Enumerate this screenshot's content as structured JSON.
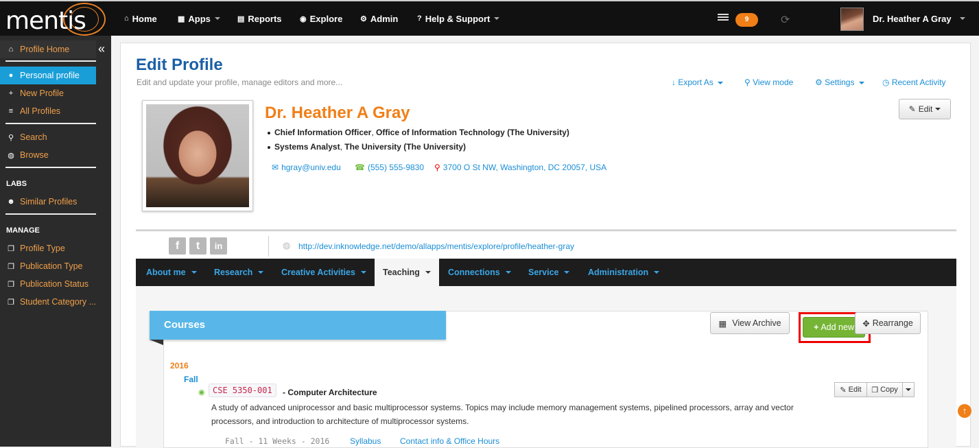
{
  "app": {
    "logo": "mentis"
  },
  "topnav": [
    {
      "icon": "home-icon",
      "glyph": "⌂",
      "label": "Home"
    },
    {
      "icon": "apps-icon",
      "glyph": "▦",
      "label": "Apps"
    },
    {
      "icon": "reports-icon",
      "glyph": "▤",
      "label": "Reports"
    },
    {
      "icon": "explore-icon",
      "glyph": "◉",
      "label": "Explore"
    },
    {
      "icon": "admin-icon",
      "glyph": "⚙",
      "label": "Admin"
    },
    {
      "icon": "help-icon",
      "glyph": "?",
      "label": "Help & Support"
    }
  ],
  "notifications": {
    "count": "9"
  },
  "user": {
    "name": "Dr. Heather A Gray"
  },
  "sidebar": {
    "collapse_glyph": "«",
    "items": [
      {
        "label": "Profile Home",
        "icon": "home-icon",
        "glyph": "⌂"
      },
      {
        "label": "Personal profile",
        "icon": "user-icon",
        "glyph": "●"
      },
      {
        "label": "New Profile",
        "icon": "plus-icon",
        "glyph": "+"
      },
      {
        "label": "All Profiles",
        "icon": "list-icon",
        "glyph": "≡"
      },
      {
        "label": "Search",
        "icon": "search-icon",
        "glyph": "⚲"
      },
      {
        "label": "Browse",
        "icon": "globe-icon",
        "glyph": "◍"
      },
      {
        "label": "Similar Profiles",
        "icon": "users-icon",
        "glyph": "☻"
      },
      {
        "label": "Profile Type",
        "icon": "copy-icon",
        "glyph": "❐"
      },
      {
        "label": "Publication Type",
        "icon": "copy-icon",
        "glyph": "❐"
      },
      {
        "label": "Publication Status",
        "icon": "copy-icon",
        "glyph": "❐"
      },
      {
        "label": "Student Category ...",
        "icon": "copy-icon",
        "glyph": "❐"
      }
    ],
    "labs_heading": "LABS",
    "manage_heading": "MANAGE"
  },
  "page": {
    "title": "Edit Profile",
    "subtitle": "Edit and update your profile, manage editors and more...",
    "links": [
      {
        "label": "Export As",
        "glyph": "↓"
      },
      {
        "label": "View mode",
        "glyph": "⚲"
      },
      {
        "label": "Settings",
        "glyph": "⚙"
      },
      {
        "label": "Recent Activity",
        "glyph": "◷"
      }
    ],
    "edit_button": "Edit"
  },
  "profile": {
    "name": "Dr. Heather A Gray",
    "positions": [
      {
        "title": "Chief Information Officer",
        "org": "Office of Information Technology (The University)"
      },
      {
        "title": "Systems Analyst",
        "org": "The University (The University)"
      }
    ],
    "email": "hgray@univ.edu",
    "phone": "(555) 555-9830",
    "address": "3700 O St NW, Washington, DC 20057, USA",
    "url": "http://dev.inknowledge.net/demo/allapps/mentis/explore/profile/heather-gray",
    "social": [
      {
        "name": "facebook-icon",
        "glyph": "f"
      },
      {
        "name": "twitter-icon",
        "glyph": "t"
      },
      {
        "name": "linkedin-icon",
        "glyph": "in"
      }
    ]
  },
  "tabs": [
    {
      "label": "About me",
      "active": false
    },
    {
      "label": "Research",
      "active": false
    },
    {
      "label": "Creative Activities",
      "active": false
    },
    {
      "label": "Teaching",
      "active": true
    },
    {
      "label": "Connections",
      "active": false
    },
    {
      "label": "Service",
      "active": false
    },
    {
      "label": "Administration",
      "active": false
    }
  ],
  "courses": {
    "header": "Courses",
    "view_archive": "View Archive",
    "add_new": "Add new",
    "rearrange": "Rearrange",
    "year": "2016",
    "season": "Fall",
    "course": {
      "code": "CSE 5350-001",
      "title": "- Computer Architecture",
      "description": "A study of advanced uniprocessor and basic multiprocessor systems. Topics may include memory management systems, pipelined processors, array and vector processors, and introduction to architecture of multiprocessor systems.",
      "meta": "Fall - 11 Weeks - 2016",
      "syllabus": "Syllabus",
      "contact": "Contact info & Office Hours",
      "edit": "Edit",
      "copy": "Copy"
    }
  },
  "colors": {
    "brand_orange": "#f07f18",
    "link_blue": "#1a8ed6",
    "title_blue": "#1b5fa6",
    "active_blue": "#199ed8",
    "add_green": "#76b436"
  }
}
